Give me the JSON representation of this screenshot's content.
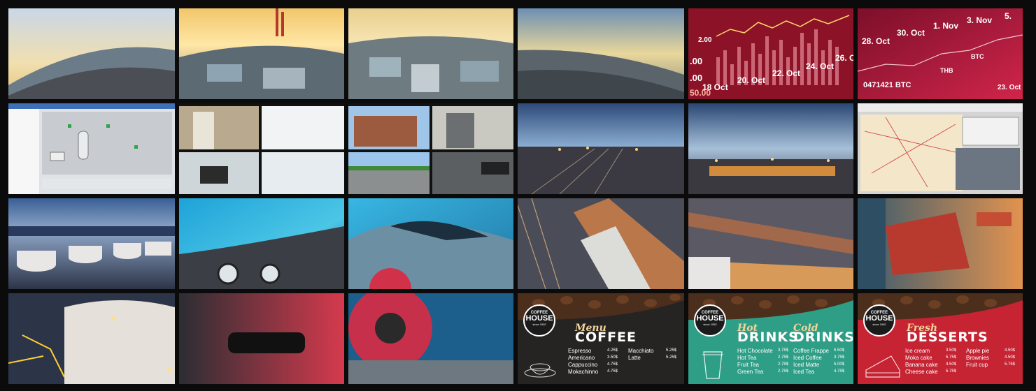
{
  "charts": {
    "dates_tile1": [
      "18 Oct",
      "20. Oct",
      "22. Oct",
      "24. Oct",
      "26. Oc"
    ],
    "values_tile1": [
      "2.00",
      ".00",
      ".00",
      "50.00"
    ],
    "dates_tile2": [
      "28. Oct",
      "30. Oct",
      "1. Nov",
      "3. Nov",
      "5."
    ],
    "tile2_extra": [
      "0471421 BTC",
      "THB",
      "BTC",
      "23. Oct"
    ]
  },
  "menus": {
    "logo": {
      "top": "COFFEE",
      "main": "HOUSE",
      "since": "since 1952"
    },
    "coffee": {
      "script": "Menu",
      "title": "COFFEE",
      "items": [
        {
          "name": "Espresso",
          "price": "4.25$"
        },
        {
          "name": "Americano",
          "price": "3.50$"
        },
        {
          "name": "Cappuccino",
          "price": "4.75$"
        },
        {
          "name": "Mokachinno",
          "price": "4.75$"
        },
        {
          "name": "Macchiato",
          "price": "5.25$"
        },
        {
          "name": "Latte",
          "price": "5.25$"
        }
      ]
    },
    "drinks": {
      "hot_script": "Hot",
      "hot_title": "DRINKS",
      "cold_script": "Cold",
      "cold_title": "DRINKS",
      "hot_items": [
        {
          "name": "Hot Chocolate",
          "price": "3.75$"
        },
        {
          "name": "Hot Tea",
          "price": "2.75$"
        },
        {
          "name": "Fruit Tea",
          "price": "2.75$"
        },
        {
          "name": "Green Tea",
          "price": "2.75$"
        }
      ],
      "cold_items": [
        {
          "name": "Coffee Frappe",
          "price": "5.50$"
        },
        {
          "name": "Iced Coffee",
          "price": "3.75$"
        },
        {
          "name": "Iced Matte",
          "price": "5.00$"
        },
        {
          "name": "Iced Tea",
          "price": "4.75$"
        }
      ]
    },
    "desserts": {
      "script": "Fresh",
      "title": "DESSERTS",
      "items": [
        {
          "name": "Ice cream",
          "price": "3.50$"
        },
        {
          "name": "Moka cake",
          "price": "5.75$"
        },
        {
          "name": "Banana cake",
          "price": "4.50$"
        },
        {
          "name": "Cheese cake",
          "price": "5.75$"
        },
        {
          "name": "Apple pie",
          "price": "4.50$"
        },
        {
          "name": "Brownies",
          "price": "4.50$"
        },
        {
          "name": "Fruit cup",
          "price": "5.75$"
        }
      ]
    }
  },
  "colors": {
    "bezel": "#0b0b0b",
    "coffee_panel": "#262423",
    "drinks_panel": "#2f9e86",
    "desserts_panel": "#c62333",
    "chart_red": "#8c1327",
    "ice_blue": "#3fb7e0"
  }
}
